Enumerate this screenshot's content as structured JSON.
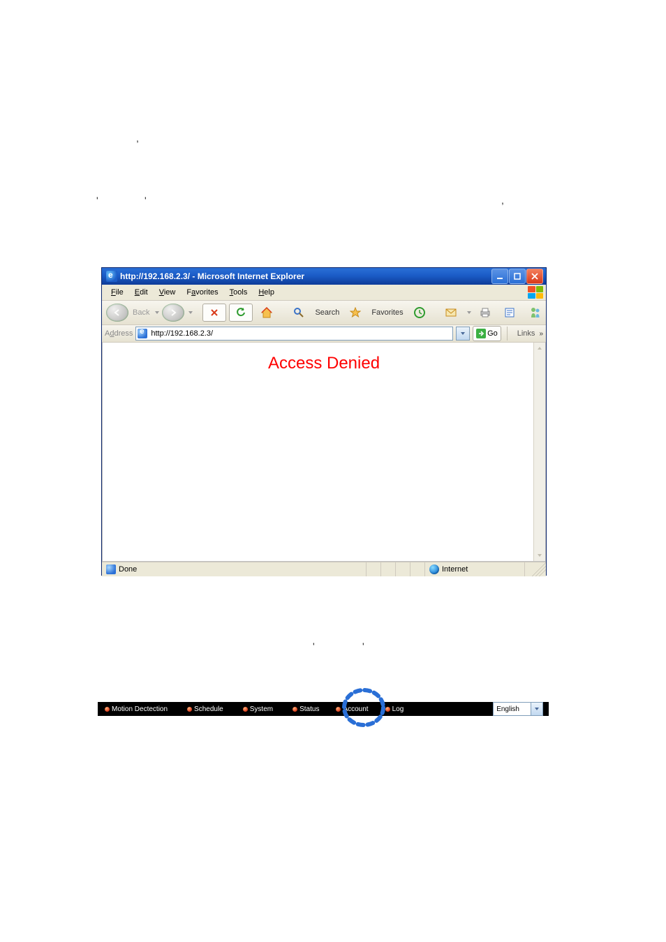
{
  "stray_chars": {
    "c1": ",",
    "c2": "'",
    "c3": "'",
    "c4": ",",
    "c5": "'",
    "c6": "'"
  },
  "ie": {
    "title": "http://192.168.2.3/ - Microsoft Internet Explorer",
    "menu": {
      "file": "File",
      "edit": "Edit",
      "view": "View",
      "favorites": "Favorites",
      "tools": "Tools",
      "help": "Help"
    },
    "toolbar": {
      "back": "Back",
      "search": "Search",
      "favorites": "Favorites"
    },
    "address_label": "Address",
    "address_value": "http://192.168.2.3/",
    "go": "Go",
    "links": "Links",
    "content_text": "Access Denied",
    "status": {
      "done": "Done",
      "zone": "Internet"
    }
  },
  "nav": {
    "items": [
      {
        "label": "Motion Dectection"
      },
      {
        "label": "Schedule"
      },
      {
        "label": "System"
      },
      {
        "label": "Status"
      },
      {
        "label": "Account"
      },
      {
        "label": "Log"
      }
    ],
    "language": "English"
  }
}
